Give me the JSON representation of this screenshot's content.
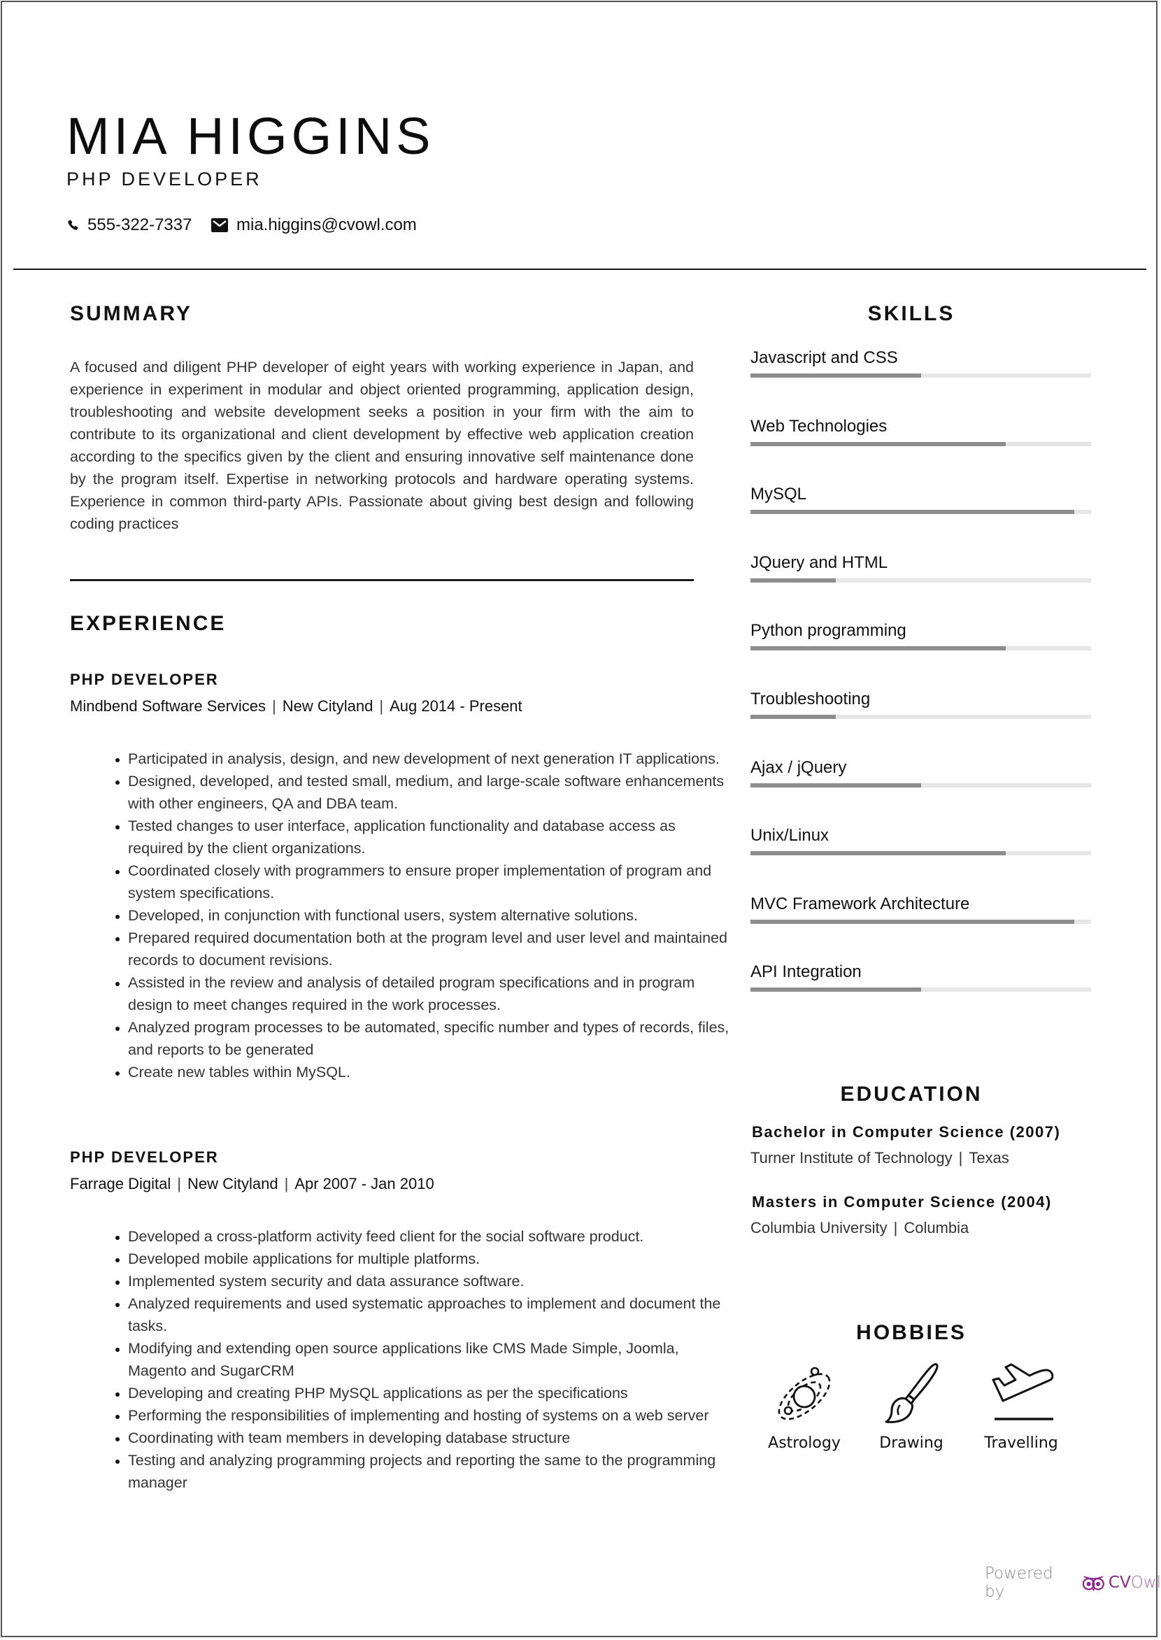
{
  "header": {
    "name": "MIA HIGGINS",
    "role": "PHP DEVELOPER",
    "phone_icon": "phone-icon",
    "phone": "555-322-7337",
    "email_icon": "envelope-icon",
    "email": "mia.higgins@cvowl.com"
  },
  "summary": {
    "title": "SUMMARY",
    "text": "A focused and diligent PHP developer of eight years with working experience in Japan, and experience in experiment in modular and object oriented programming, application design, troubleshooting and website development seeks a position in your firm with the aim to contribute to its organizational and client development by effective web application creation according to the specifics given by the client and ensuring innovative self maintenance done by the program itself. Expertise in networking protocols and hardware operating systems. Experience in common third-party APIs. Passionate about giving best design and following coding practices"
  },
  "experience": {
    "title": "EXPERIENCE",
    "jobs": [
      {
        "title": "PHP DEVELOPER",
        "company": "Mindbend Software Services",
        "location": "New Cityland",
        "dates": "Aug 2014 - Present",
        "bullets": [
          "Participated in analysis, design, and new development of next generation IT applications.",
          "Designed, developed, and tested small, medium, and large-scale software enhancements with other engineers, QA and DBA team.",
          "Tested changes to user interface, application functionality and database access as required by the client organizations.",
          "Coordinated closely with programmers to ensure proper implementation of program and system specifications.",
          "Developed, in conjunction with functional users, system alternative solutions.",
          "Prepared required documentation both at the program level and user level and maintained records to document revisions.",
          "Assisted in the review and analysis of detailed program specifications and in program design to meet changes required in the work processes.",
          "Analyzed program processes to be automated, specific number and types of records, files, and reports to be generated",
          "Create new tables within MySQL."
        ]
      },
      {
        "title": "PHP DEVELOPER",
        "company": "Farrage Digital",
        "location": "New Cityland",
        "dates": "Apr 2007 - Jan 2010",
        "bullets": [
          "Developed a cross-platform activity feed client for the social software product.",
          "Developed mobile applications for multiple platforms.",
          "Implemented system security and data assurance software.",
          "Analyzed requirements and used systematic approaches to implement and document the tasks.",
          "Modifying and extending open source applications like CMS Made Simple, Joomla, Magento and SugarCRM",
          "Developing and creating PHP MySQL applications as per the specifications",
          "Performing the responsibilities of implementing and hosting of systems on a web server",
          "Coordinating with team members in developing database structure",
          "Testing and analyzing programming projects and reporting the same to the programming manager"
        ]
      }
    ]
  },
  "skills": {
    "title": "SKILLS",
    "bar_fill_color": "#8d8d8d",
    "bar_track_color": "#e6e6e6",
    "items": [
      {
        "label": "Javascript and CSS",
        "level_percent": 50
      },
      {
        "label": "Web Technologies",
        "level_percent": 75
      },
      {
        "label": "MySQL",
        "level_percent": 95
      },
      {
        "label": "JQuery and HTML",
        "level_percent": 25
      },
      {
        "label": "Python programming",
        "level_percent": 75
      },
      {
        "label": "Troubleshooting",
        "level_percent": 25
      },
      {
        "label": "Ajax / jQuery",
        "level_percent": 50
      },
      {
        "label": "Unix/Linux",
        "level_percent": 75
      },
      {
        "label": "MVC Framework Architecture",
        "level_percent": 95
      },
      {
        "label": "API Integration",
        "level_percent": 50
      }
    ]
  },
  "education": {
    "title": "EDUCATION",
    "items": [
      {
        "degree": "Bachelor in Computer Science (2007)",
        "school": "Turner Institute of Technology",
        "location": "Texas"
      },
      {
        "degree": "Masters in Computer Science (2004)",
        "school": "Columbia University",
        "location": "Columbia"
      }
    ]
  },
  "hobbies": {
    "title": "HOBBIES",
    "items": [
      {
        "label": "Astrology",
        "icon": "astrology-icon"
      },
      {
        "label": "Drawing",
        "icon": "paintbrush-icon"
      },
      {
        "label": "Travelling",
        "icon": "airplane-takeoff-icon"
      }
    ]
  },
  "footer": {
    "powered_by": "Powered by",
    "brand_strong": "CV",
    "brand_light": "Owl",
    "brand_color": "#8b2a8b"
  },
  "separator": "|"
}
